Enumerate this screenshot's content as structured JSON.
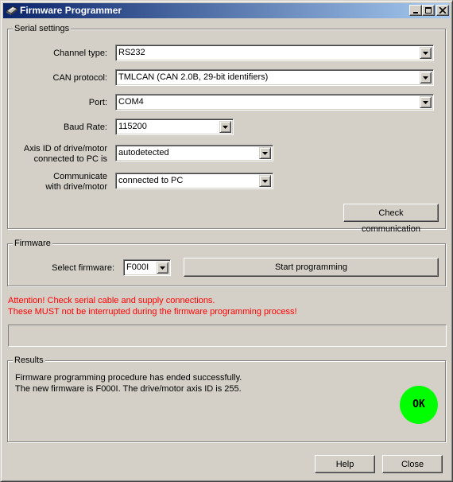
{
  "window": {
    "title": "Firmware Programmer"
  },
  "serial": {
    "legend": "Serial settings",
    "channel_label": "Channel type:",
    "channel_value": "RS232",
    "protocol_label": "CAN protocol:",
    "protocol_value": "TMLCAN (CAN 2.0B, 29-bit identifiers)",
    "port_label": "Port:",
    "port_value": "COM4",
    "baud_label": "Baud Rate:",
    "baud_value": "115200",
    "axis_label_1": "Axis ID of drive/motor",
    "axis_label_2": "connected to PC is",
    "axis_value": "autodetected",
    "comm_label_1": "Communicate",
    "comm_label_2": "with drive/motor",
    "comm_value": "connected to PC",
    "check_button": "Check communication"
  },
  "firmware": {
    "legend": "Firmware",
    "select_label": "Select firmware:",
    "select_value": "F000I",
    "start_button": "Start programming"
  },
  "warning": {
    "line1": "Attention! Check serial cable and supply connections.",
    "line2": "These MUST not be interrupted during the firmware programming process!",
    "color": "#ff0000"
  },
  "progress": {
    "fraction": 0
  },
  "results": {
    "legend": "Results",
    "line1": "Firmware programming procedure has ended successfully.",
    "line2": "The new firmware is F000I. The drive/motor axis ID is 255.",
    "status": "OK",
    "status_color": "#00ff00"
  },
  "footer": {
    "help_button": "Help",
    "close_button": "Close"
  },
  "icons": {
    "app": "programmer-chip-icon",
    "minimize": "minimize-icon",
    "maximize": "maximize-icon",
    "close": "close-icon",
    "dropdown": "chevron-down-icon"
  }
}
